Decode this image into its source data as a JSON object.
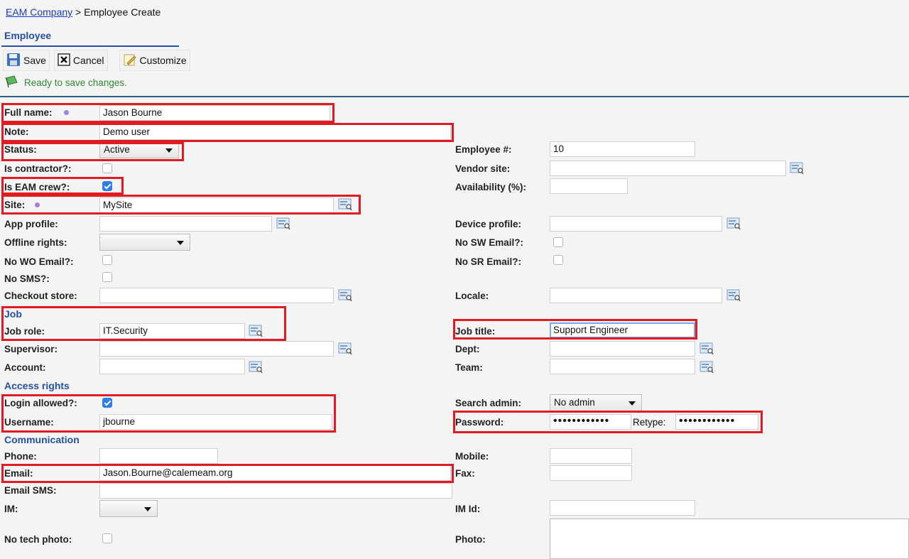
{
  "breadcrumb": {
    "link": "EAM Company",
    "separator": ">",
    "current": "Employee Create"
  },
  "page_title": "Employee",
  "toolbar": {
    "save": "Save",
    "cancel": "Cancel",
    "customize": "Customize"
  },
  "status_message": "Ready to save changes.",
  "form": {
    "full_name": {
      "label": "Full name:",
      "value": "Jason Bourne"
    },
    "note": {
      "label": "Note:",
      "value": "Demo user"
    },
    "status": {
      "label": "Status:",
      "value": "Active"
    },
    "is_contractor": {
      "label": "Is contractor?:",
      "checked": false
    },
    "is_eam_crew": {
      "label": "Is EAM crew?:",
      "checked": true
    },
    "site": {
      "label": "Site:",
      "value": "MySite"
    },
    "app_profile": {
      "label": "App profile:",
      "value": ""
    },
    "offline_rights": {
      "label": "Offline rights:",
      "value": ""
    },
    "no_wo_email": {
      "label": "No WO Email?:",
      "checked": false
    },
    "no_sms": {
      "label": "No SMS?:",
      "checked": false
    },
    "checkout_store": {
      "label": "Checkout store:",
      "value": ""
    },
    "employee_no": {
      "label": "Employee #:",
      "value": "10"
    },
    "vendor_site": {
      "label": "Vendor site:",
      "value": ""
    },
    "availability": {
      "label": "Availability (%):",
      "value": ""
    },
    "device_profile": {
      "label": "Device profile:",
      "value": ""
    },
    "no_sw_email": {
      "label": "No SW Email?:",
      "checked": false
    },
    "no_sr_email": {
      "label": "No SR Email?:",
      "checked": false
    },
    "locale": {
      "label": "Locale:",
      "value": ""
    }
  },
  "job": {
    "section_title": "Job",
    "job_role": {
      "label": "Job role:",
      "value": "IT.Security"
    },
    "supervisor": {
      "label": "Supervisor:",
      "value": ""
    },
    "account": {
      "label": "Account:",
      "value": ""
    },
    "job_title": {
      "label": "Job title:",
      "value": "Support Engineer"
    },
    "dept": {
      "label": "Dept:",
      "value": ""
    },
    "team": {
      "label": "Team:",
      "value": ""
    }
  },
  "access": {
    "section_title": "Access rights",
    "login_allowed": {
      "label": "Login allowed?:",
      "checked": true
    },
    "username": {
      "label": "Username:",
      "value": "jbourne"
    },
    "search_admin": {
      "label": "Search admin:",
      "value": "No admin"
    },
    "password": {
      "label": "Password:",
      "value": "••••••••••••"
    },
    "retype": {
      "label": "Retype:",
      "value": "••••••••••••"
    }
  },
  "communication": {
    "section_title": "Communication",
    "phone": {
      "label": "Phone:",
      "value": ""
    },
    "email": {
      "label": "Email:",
      "value": "Jason.Bourne@calemeam.org"
    },
    "email_sms": {
      "label": "Email SMS:",
      "value": ""
    },
    "im": {
      "label": "IM:",
      "value": ""
    },
    "no_tech_photo": {
      "label": "No tech photo:",
      "checked": false
    },
    "mobile": {
      "label": "Mobile:",
      "value": ""
    },
    "fax": {
      "label": "Fax:",
      "value": ""
    },
    "im_id": {
      "label": "IM Id:",
      "value": ""
    },
    "photo": {
      "label": "Photo:"
    }
  },
  "colors": {
    "highlight": "#e11b22",
    "section": "#2550a8",
    "checkbox_on": "#2f7fe8",
    "status": "#2f8a2f"
  },
  "icons": {
    "save": "floppy-disk-icon",
    "cancel": "close-box-icon",
    "customize": "pencil-form-icon",
    "status": "flag-icon",
    "lookup": "lookup-list-icon",
    "required": "required-dot-icon"
  }
}
